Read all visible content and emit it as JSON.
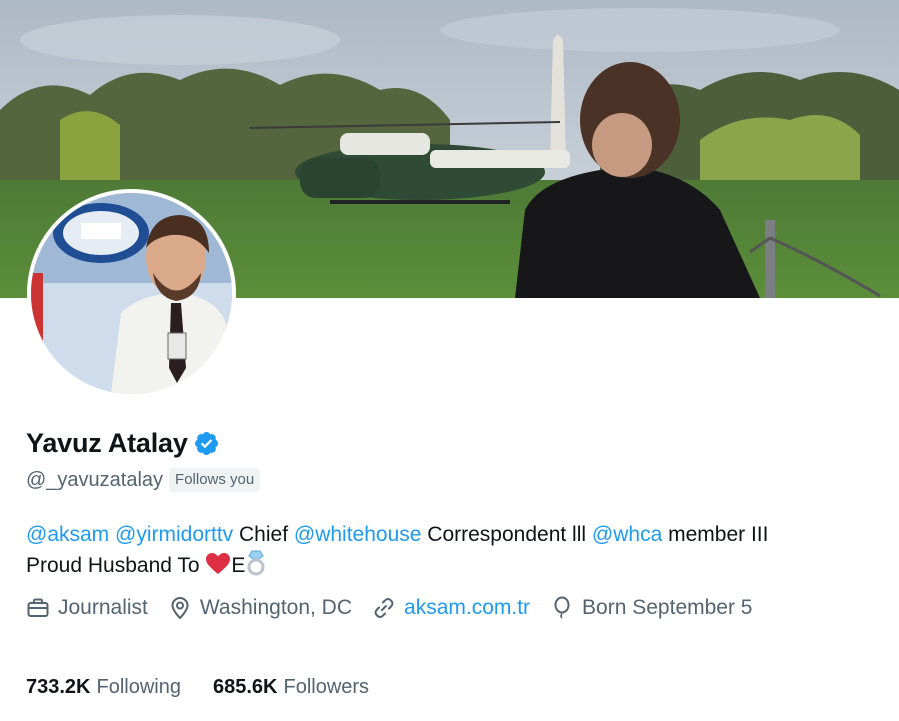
{
  "profile": {
    "display_name": "Yavuz Atalay",
    "handle": "@_yavuzatalay",
    "follows_you": "Follows you",
    "verified": true
  },
  "bio": {
    "mention_1": "@aksam",
    "mention_2": "@yirmidorttv",
    "text_1": "Chief",
    "mention_3": "@whitehouse",
    "text_2": "Correspondent lll",
    "mention_4": "@whca",
    "text_3": "member III",
    "text_4": "Proud Husband To",
    "text_5": "E"
  },
  "meta": {
    "profession": "Journalist",
    "location": "Washington, DC",
    "website": "aksam.com.tr",
    "birthday": "Born September 5"
  },
  "stats": {
    "following_count": "733.2K",
    "following_label": "Following",
    "followers_count": "685.6K",
    "followers_label": "Followers"
  },
  "colors": {
    "accent": "#1d9bf0",
    "secondary_text": "#536471",
    "primary_text": "#0f1419"
  },
  "icons": [
    "verified-badge-icon",
    "briefcase-icon",
    "location-pin-icon",
    "link-icon",
    "balloon-icon",
    "red-heart-emoji",
    "ring-emoji"
  ]
}
